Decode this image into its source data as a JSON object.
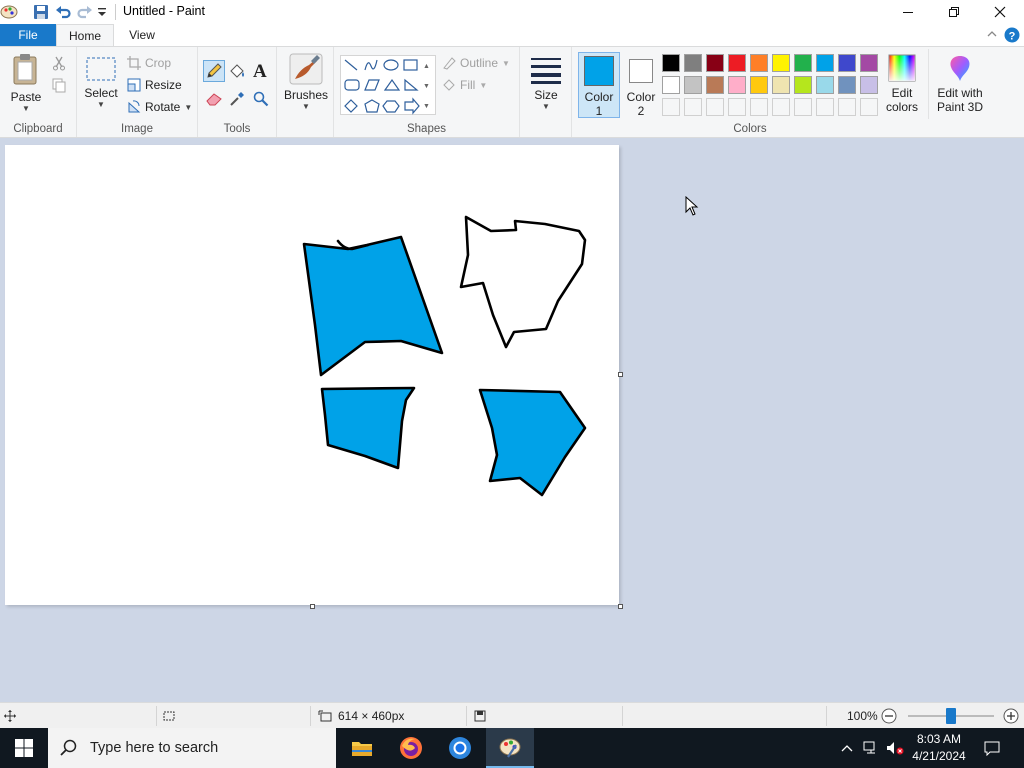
{
  "window": {
    "title": "Untitled - Paint"
  },
  "tabs": {
    "file": "File",
    "home": "Home",
    "view": "View"
  },
  "clipboard": {
    "paste": "Paste",
    "group": "Clipboard"
  },
  "image": {
    "select": "Select",
    "crop": "Crop",
    "resize": "Resize",
    "rotate": "Rotate",
    "group": "Image"
  },
  "tools": {
    "group": "Tools"
  },
  "brushes": {
    "label": "Brushes"
  },
  "shapes": {
    "outline": "Outline",
    "fill": "Fill",
    "group": "Shapes"
  },
  "size": {
    "label": "Size"
  },
  "colors": {
    "color1_label": "Color",
    "color1_num": "1",
    "color2_label": "Color",
    "color2_num": "2",
    "edit_colors_1": "Edit",
    "edit_colors_2": "colors",
    "paint3d_1": "Edit with",
    "paint3d_2": "Paint 3D",
    "group": "Colors",
    "color1_value": "#00a2e8",
    "color2_value": "#ffffff",
    "palette_row1": [
      "#000000",
      "#7f7f7f",
      "#880015",
      "#ed1c24",
      "#ff7f27",
      "#fff200",
      "#22b14c",
      "#00a2e8",
      "#3f48cc",
      "#a349a4"
    ],
    "palette_row2": [
      "#ffffff",
      "#c3c3c3",
      "#b97a57",
      "#ffaec9",
      "#ffc90e",
      "#efe4b0",
      "#b5e61d",
      "#99d9ea",
      "#7092be",
      "#c8bfe7"
    ]
  },
  "status": {
    "dimensions": "614 × 460px",
    "zoom": "100%"
  },
  "taskbar": {
    "search_placeholder": "Type here to search",
    "time": "8:03 AM",
    "date": "4/21/2024"
  },
  "canvas_fill_color": "#00a2e8"
}
